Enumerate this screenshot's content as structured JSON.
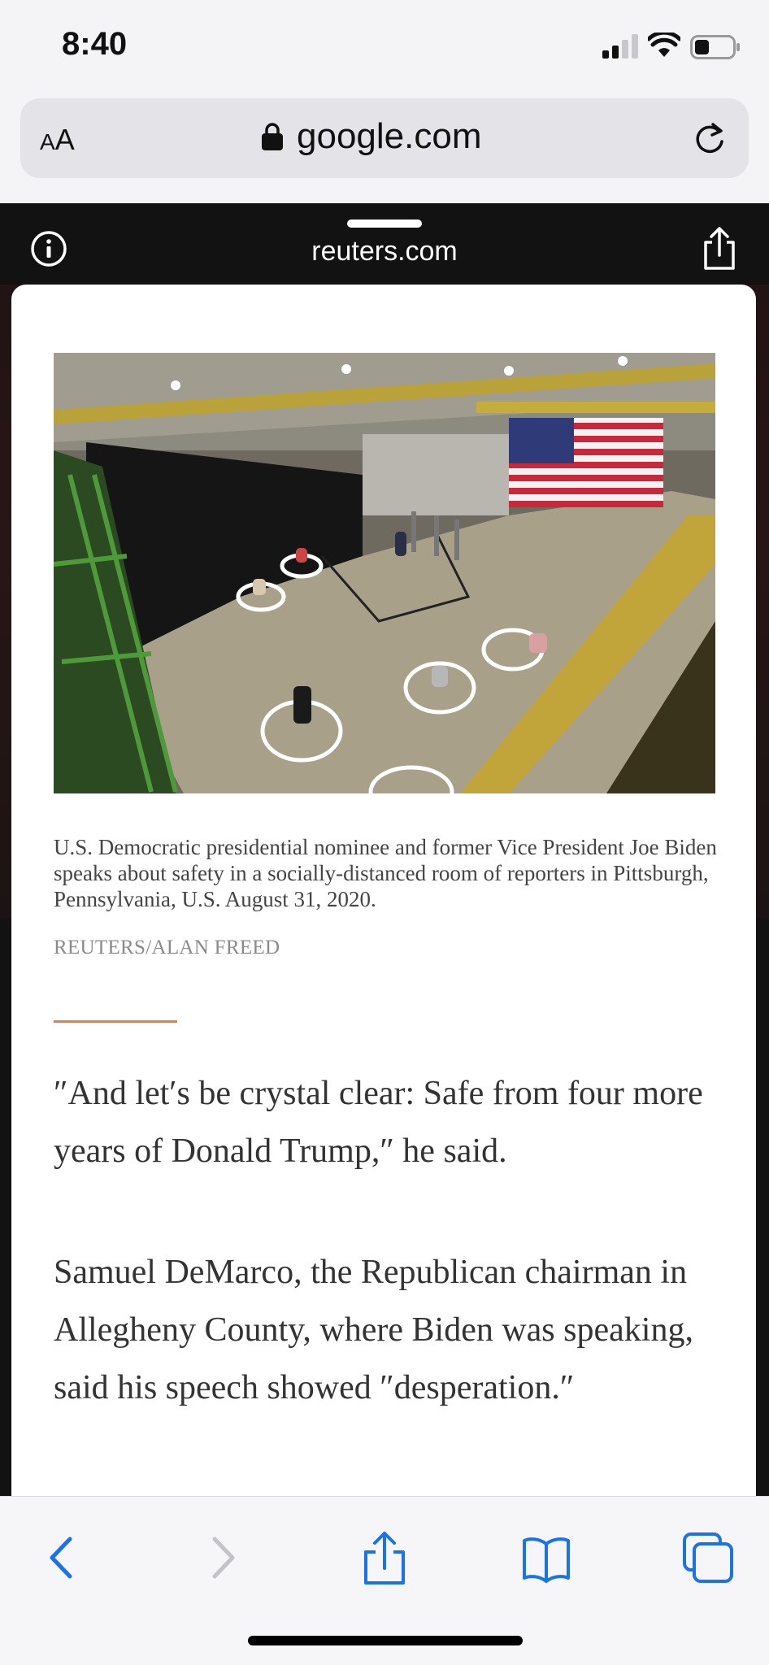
{
  "status_bar": {
    "time": "8:40"
  },
  "url_bar": {
    "text_size_small": "A",
    "text_size_big": "A",
    "domain": "google.com"
  },
  "amp_header": {
    "site": "reuters.com"
  },
  "article": {
    "photo_alt": "Biden speaking in a socially-distanced room of reporters",
    "caption": "U.S. Democratic presidential nominee and former Vice President Joe Biden speaks about safety in a socially-distanced room of reporters in Pittsburgh, Pennsylvania, U.S. August 31, 2020.",
    "credit": "REUTERS/ALAN FREED",
    "paragraphs": [
      "″And let′s be crystal clear: Safe from four more years of Donald Trump,″ he said.",
      "Samuel DeMarco, the Republican chairman in Allegheny County, where Biden was speaking, said his speech showed ″desperation.″"
    ]
  },
  "colors": {
    "accent_rule": "#e87d45",
    "ios_blue": "#1a73e8",
    "disabled": "#c4c4c8"
  }
}
